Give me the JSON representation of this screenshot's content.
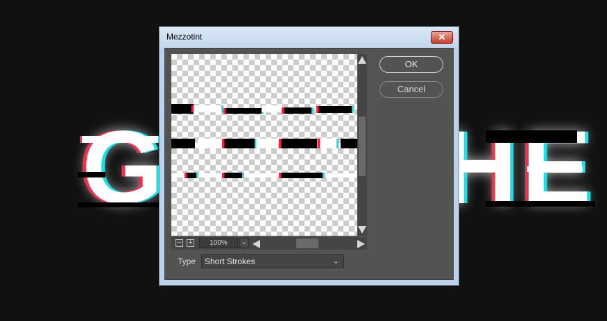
{
  "dialog": {
    "title": "Mezzotint",
    "close_icon": "close-icon",
    "ok_label": "OK",
    "cancel_label": "Cancel",
    "zoom_value": "100%",
    "zoom_out_icon": "minus-icon",
    "zoom_in_icon": "plus-icon",
    "type_label": "Type",
    "type_value": "Short Strokes"
  },
  "colors": {
    "background": "#111111",
    "panel": "#535353",
    "glitch_red": "#ff2a4a",
    "glitch_cyan": "#1de0e6"
  }
}
